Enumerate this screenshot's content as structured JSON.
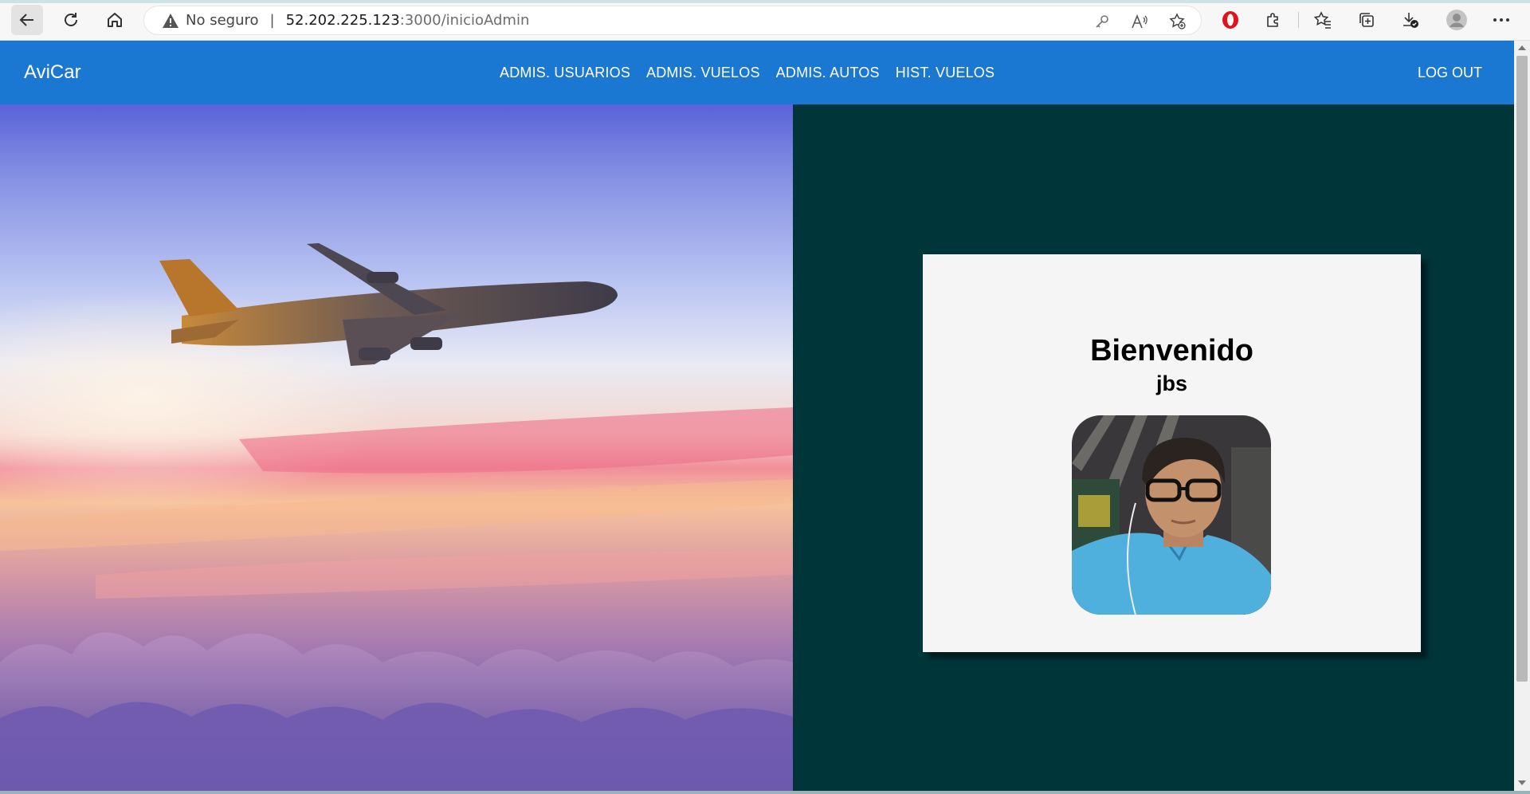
{
  "browser": {
    "security_label": "No seguro",
    "separator": "|",
    "url_host": "52.202.225.123",
    "url_path": ":3000/inicioAdmin",
    "icons": [
      "back-arrow-icon",
      "refresh-icon",
      "home-icon",
      "warning-icon",
      "key-icon",
      "read-aloud-icon",
      "add-favorite-icon",
      "opera-icon",
      "extensions-icon",
      "favorites-icon",
      "collections-icon",
      "downloads-icon",
      "profile-icon",
      "more-icon"
    ]
  },
  "navbar": {
    "brand": "AviCar",
    "menu": [
      {
        "label": "ADMIS. USUARIOS"
      },
      {
        "label": "ADMIS. VUELOS"
      },
      {
        "label": "ADMIS. AUTOS"
      },
      {
        "label": "HIST. VUELOS"
      }
    ],
    "logout": "LOG OUT",
    "color": "#1a78d2"
  },
  "welcome": {
    "title": "Bienvenido",
    "username": "jbs"
  },
  "colors": {
    "panel_bg": "#00353a",
    "card_bg": "#f5f5f5"
  }
}
